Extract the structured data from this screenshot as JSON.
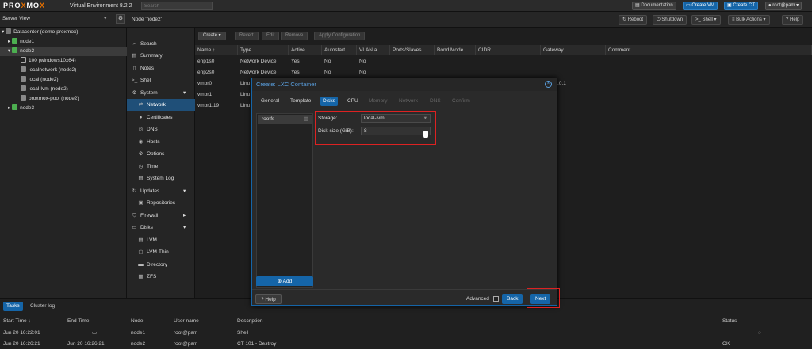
{
  "topbar": {
    "logo_a": "PRO",
    "logo_x": "X",
    "logo_b": "MO",
    "logo_x2": "X",
    "product": "Virtual Environment 8.2.2",
    "search_placeholder": "Search",
    "documentation": "Documentation",
    "create_vm": "Create VM",
    "create_ct": "Create CT",
    "user": "root@pam"
  },
  "server_view": {
    "label": "Server View",
    "node_title": "Node 'node2'"
  },
  "toolbar_right": {
    "reboot": "Reboot",
    "shutdown": "Shutdown",
    "shell": "Shell",
    "bulk_actions": "Bulk Actions",
    "help": "Help"
  },
  "tree": [
    {
      "label": "Datacenter (demo-proxmox)",
      "indent": 0
    },
    {
      "label": "node1",
      "indent": 1
    },
    {
      "label": "node2",
      "indent": 1
    },
    {
      "label": "100 (windows10x64)",
      "indent": 2
    },
    {
      "label": "localnetwork (node2)",
      "indent": 2
    },
    {
      "label": "local (node2)",
      "indent": 2
    },
    {
      "label": "local-lvm (node2)",
      "indent": 2
    },
    {
      "label": "proxmox-pool (node2)",
      "indent": 2
    },
    {
      "label": "node3",
      "indent": 1
    }
  ],
  "nav": [
    {
      "label": "Search",
      "icon": "search-icon"
    },
    {
      "label": "Summary",
      "icon": "summary-icon"
    },
    {
      "label": "Notes",
      "icon": "notes-icon"
    },
    {
      "label": "Shell",
      "icon": "terminal-icon"
    },
    {
      "label": "System",
      "icon": "gears-icon"
    },
    {
      "label": "Network",
      "icon": "network-icon"
    },
    {
      "label": "Certificates",
      "icon": "certificate-icon"
    },
    {
      "label": "DNS",
      "icon": "dns-icon"
    },
    {
      "label": "Hosts",
      "icon": "hosts-icon"
    },
    {
      "label": "Options",
      "icon": "options-icon"
    },
    {
      "label": "Time",
      "icon": "clock-icon"
    },
    {
      "label": "System Log",
      "icon": "log-icon"
    },
    {
      "label": "Updates",
      "icon": "updates-icon"
    },
    {
      "label": "Repositories",
      "icon": "repository-icon"
    },
    {
      "label": "Firewall",
      "icon": "firewall-icon"
    },
    {
      "label": "Disks",
      "icon": "disks-icon"
    },
    {
      "label": "LVM",
      "icon": "lvm-icon"
    },
    {
      "label": "LVM-Thin",
      "icon": "lvm-thin-icon"
    },
    {
      "label": "Directory",
      "icon": "folder-icon"
    },
    {
      "label": "ZFS",
      "icon": "zfs-icon"
    }
  ],
  "grid_toolbar": {
    "create": "Create",
    "revert": "Revert",
    "edit": "Edit",
    "remove": "Remove",
    "apply": "Apply Configuration"
  },
  "grid": {
    "columns": [
      "Name ↑",
      "Type",
      "Active",
      "Autostart",
      "VLAN a...",
      "Ports/Slaves",
      "Bond Mode",
      "CIDR",
      "Gateway",
      "Comment"
    ],
    "rows": [
      [
        "enp1s0",
        "Network Device",
        "Yes",
        "No",
        "No"
      ],
      [
        "enp2s0",
        "Network Device",
        "Yes",
        "No",
        "No"
      ],
      [
        "vmbr0",
        "Linu",
        "",
        "",
        ""
      ],
      [
        "vmbr1",
        "Linu",
        "",
        "",
        ""
      ],
      [
        "vmbr1.19",
        "Linu",
        "",
        "",
        ""
      ]
    ],
    "gateway_fragment": ".0.1"
  },
  "modal": {
    "title": "Create: LXC Container",
    "tabs": [
      {
        "label": "General",
        "state": "normal"
      },
      {
        "label": "Template",
        "state": "normal"
      },
      {
        "label": "Disks",
        "state": "selected"
      },
      {
        "label": "CPU",
        "state": "normal"
      },
      {
        "label": "Memory",
        "state": "disabled"
      },
      {
        "label": "Network",
        "state": "disabled"
      },
      {
        "label": "DNS",
        "state": "disabled"
      },
      {
        "label": "Confirm",
        "state": "disabled"
      }
    ],
    "disk_item": "rootfs",
    "add_label": "Add",
    "storage_label": "Storage:",
    "storage_value": "local-lvm",
    "disk_size_label": "Disk size (GiB):",
    "disk_size_value": "8",
    "help": "Help",
    "advanced": "Advanced",
    "back": "Back",
    "next": "Next"
  },
  "tasks": {
    "tab_tasks": "Tasks",
    "tab_cluster": "Cluster log",
    "columns": [
      "Start Time ↓",
      "End Time",
      "Node",
      "User name",
      "Description",
      "Status"
    ],
    "rows": [
      [
        "Jun 20 16:22:01",
        "",
        "node1",
        "root@pam",
        "Shell",
        ""
      ],
      [
        "Jun 20 16:26:21",
        "Jun 20 16:26:21",
        "node2",
        "root@pam",
        "CT 101 - Destroy",
        "OK"
      ]
    ]
  }
}
